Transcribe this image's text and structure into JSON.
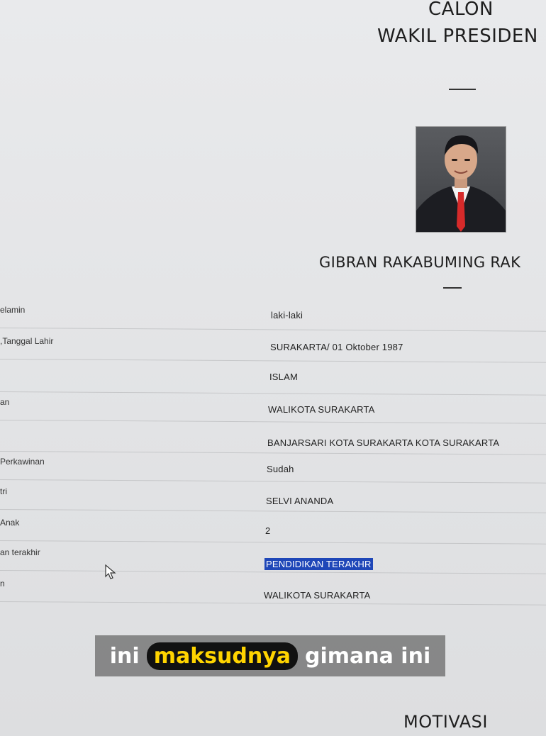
{
  "header": {
    "line1": "CALON",
    "line2": "WAKIL PRESIDEN"
  },
  "candidate_name": "GIBRAN RAKABUMING RAK",
  "profile_rows": [
    {
      "label": "elamin",
      "value": "laki-laki"
    },
    {
      "label": ",Tanggal Lahir",
      "value": "SURAKARTA/ 01 Oktober 1987"
    },
    {
      "label": "",
      "value": "ISLAM"
    },
    {
      "label": "an",
      "value": "WALIKOTA SURAKARTA"
    },
    {
      "label": "",
      "value": "BANJARSARI KOTA SURAKARTA KOTA SURAKARTA"
    },
    {
      "label": "Perkawinan",
      "value": "Sudah"
    },
    {
      "label": "tri",
      "value": "SELVI ANANDA"
    },
    {
      "label": "Anak",
      "value": "2"
    },
    {
      "label": "an terakhir",
      "value": "PENDIDIKAN TERAKHR"
    },
    {
      "label": "n",
      "value": "WALIKOTA SURAKARTA"
    }
  ],
  "caption": {
    "part1": "ini",
    "highlight": "maksudnya",
    "part2": "gimana ini"
  },
  "next_section": "MOTIVASI",
  "colors": {
    "selection": "#1f47b8",
    "caption_highlight": "#ffd400"
  },
  "icons": {
    "cursor": "mouse-pointer-icon"
  }
}
